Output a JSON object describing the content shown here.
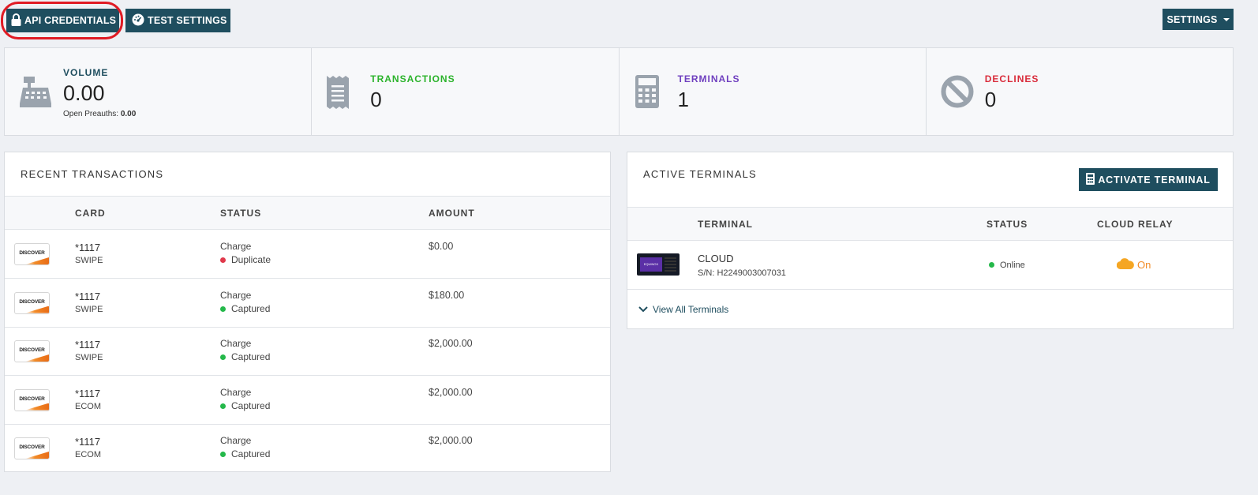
{
  "toolbar": {
    "api_credentials_label": "API CREDENTIALS",
    "test_settings_label": "TEST SETTINGS",
    "settings_label": "SETTINGS"
  },
  "stats": {
    "volume": {
      "label": "VOLUME",
      "value": "0.00",
      "sub_label": "Open Preauths:",
      "sub_value": "0.00",
      "color": "#1f4e5f"
    },
    "transactions": {
      "label": "TRANSACTIONS",
      "value": "0",
      "color": "#2bb32b"
    },
    "terminals": {
      "label": "TERMINALS",
      "value": "1",
      "color": "#6f3fbf"
    },
    "declines": {
      "label": "DECLINES",
      "value": "0",
      "color": "#d92b3a"
    }
  },
  "recent": {
    "title": "RECENT TRANSACTIONS",
    "columns": {
      "card": "CARD",
      "status": "STATUS",
      "amount": "AMOUNT"
    },
    "rows": [
      {
        "logo": "DISCOVER",
        "card": "*1117",
        "entry": "SWIPE",
        "type": "Charge",
        "status": "Duplicate",
        "status_color": "red",
        "amount": "$0.00"
      },
      {
        "logo": "DISCOVER",
        "card": "*1117",
        "entry": "SWIPE",
        "type": "Charge",
        "status": "Captured",
        "status_color": "green",
        "amount": "$180.00"
      },
      {
        "logo": "DISCOVER",
        "card": "*1117",
        "entry": "SWIPE",
        "type": "Charge",
        "status": "Captured",
        "status_color": "green",
        "amount": "$2,000.00"
      },
      {
        "logo": "DISCOVER",
        "card": "*1117",
        "entry": "ECOM",
        "type": "Charge",
        "status": "Captured",
        "status_color": "green",
        "amount": "$2,000.00"
      },
      {
        "logo": "DISCOVER",
        "card": "*1117",
        "entry": "ECOM",
        "type": "Charge",
        "status": "Captured",
        "status_color": "green",
        "amount": "$2,000.00"
      }
    ]
  },
  "active": {
    "title": "ACTIVE TERMINALS",
    "activate_label": "ACTIVATE TERMINAL",
    "columns": {
      "terminal": "TERMINAL",
      "status": "STATUS",
      "cloud_relay": "CLOUD RELAY"
    },
    "terminals": [
      {
        "screen_text": "EQUINOX",
        "name": "CLOUD",
        "serial": "S/N: H2249003007031",
        "status": "Online",
        "relay": "On"
      }
    ],
    "view_all_label": "View All Terminals"
  }
}
